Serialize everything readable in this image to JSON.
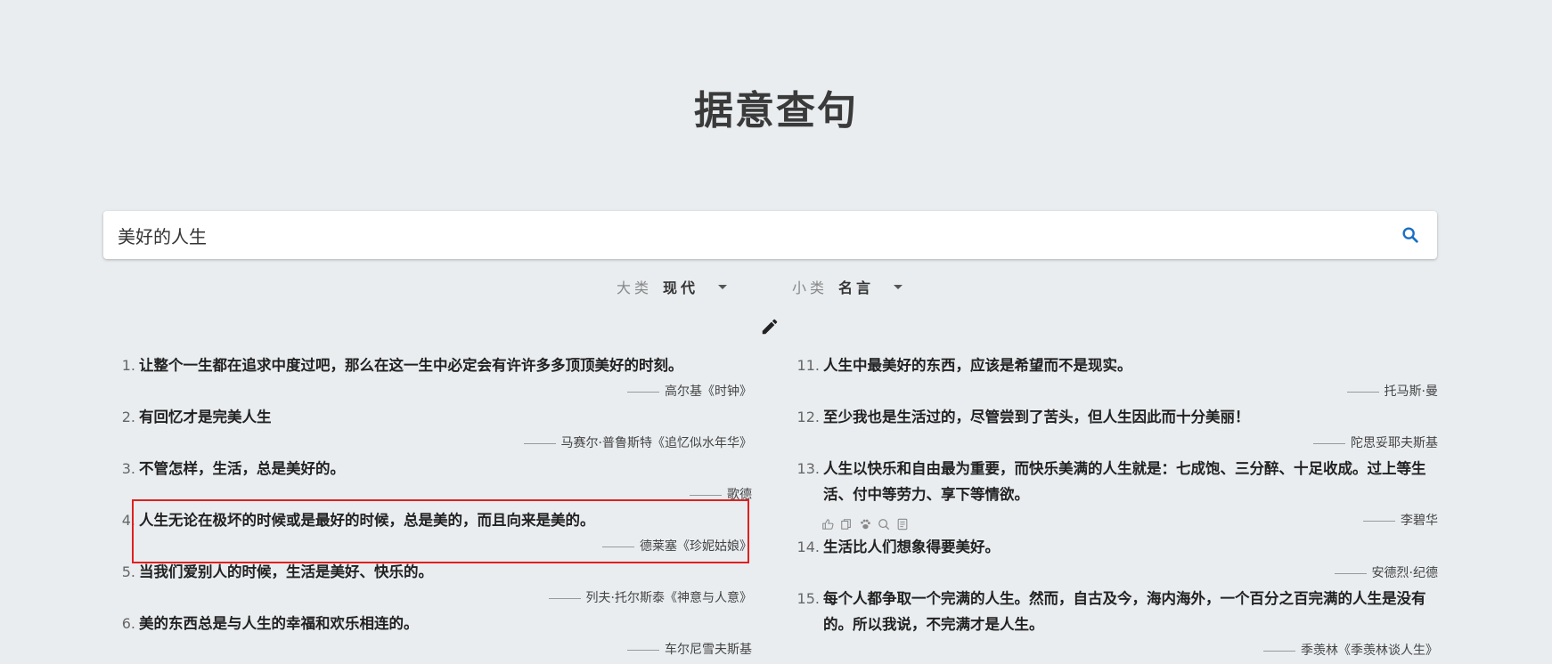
{
  "title": "据意查句",
  "search": {
    "value": "美好的人生"
  },
  "filters": {
    "major": {
      "label": "大类",
      "value": "现代"
    },
    "minor": {
      "label": "小类",
      "value": "名言"
    }
  },
  "quotes_left": [
    {
      "num": "1.",
      "text": "让整个一生都在追求中度过吧，那么在这一生中必定会有许许多多顶顶美好的时刻。",
      "author": "高尔基《时钟》"
    },
    {
      "num": "2.",
      "text": "有回忆才是完美人生",
      "author": "马赛尔·普鲁斯特《追忆似水年华》"
    },
    {
      "num": "3.",
      "text": "不管怎样，生活，总是美好的。",
      "author": "歌德"
    },
    {
      "num": "4.",
      "text": "人生无论在极坏的时候或是最好的时候，总是美的，而且向来是美的。",
      "author": "德莱塞《珍妮姑娘》"
    },
    {
      "num": "5.",
      "text": "当我们爱别人的时候，生活是美好、快乐的。",
      "author": "列夫·托尔斯泰《神意与人意》"
    },
    {
      "num": "6.",
      "text": "美的东西总是与人生的幸福和欢乐相连的。",
      "author": "车尔尼雪夫斯基"
    }
  ],
  "quotes_right": [
    {
      "num": "11.",
      "text": "人生中最美好的东西，应该是希望而不是现实。",
      "author": "托马斯·曼"
    },
    {
      "num": "12.",
      "text": "至少我也是生活过的，尽管尝到了苦头，但人生因此而十分美丽！",
      "author": "陀思妥耶夫斯基"
    },
    {
      "num": "13.",
      "text": "人生以快乐和自由最为重要，而快乐美满的人生就是：七成饱、三分醉、十足收成。过上等生活、付中等劳力、享下等情欲。",
      "author": "李碧华"
    },
    {
      "num": "14.",
      "text": "生活比人们想象得要美好。",
      "author": "安德烈·纪德"
    },
    {
      "num": "15.",
      "text": "每个人都争取一个完满的人生。然而，自古及今，海内海外，一个百分之百完满的人生是没有的。所以我说，不完满才是人生。",
      "author": "季羡林《季羡林谈人生》"
    }
  ]
}
